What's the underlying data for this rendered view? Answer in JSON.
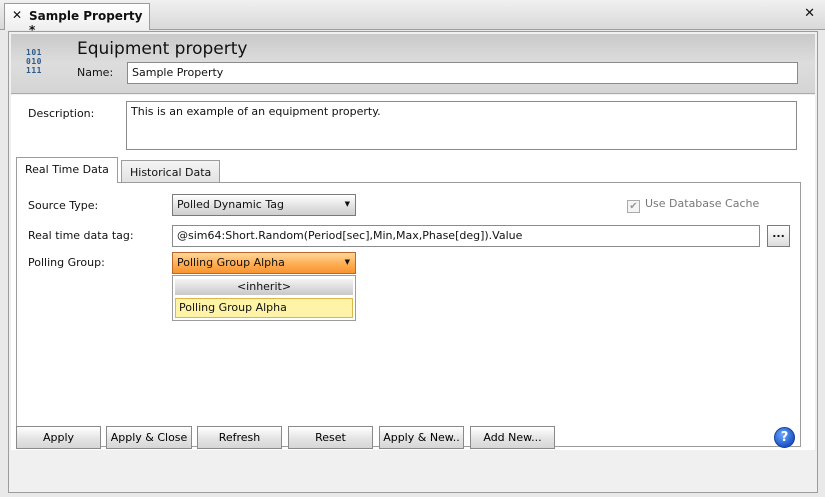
{
  "doc_tab": {
    "title": "Sample Property *",
    "close_glyph": "✕"
  },
  "window_close_glyph": "✕",
  "header": {
    "icon_name": "binary-data-icon",
    "icon_lines": [
      "101",
      "010",
      "111"
    ],
    "title": "Equipment property",
    "name_label": "Name:",
    "name_value": "Sample Property"
  },
  "description": {
    "label": "Description:",
    "value": "This is an example of an equipment property."
  },
  "tabs": [
    {
      "label": "Real Time Data",
      "active": true
    },
    {
      "label": "Historical Data",
      "active": false
    }
  ],
  "realtime": {
    "source_type_label": "Source Type:",
    "source_type_value": "Polled Dynamic Tag",
    "use_cache_label": "Use Database Cache",
    "use_cache_checked": true,
    "tag_label": "Real time data tag:",
    "tag_value": "@sim64:Short.Random(Period[sec],Min,Max,Phase[deg]).Value",
    "browse_label": "...",
    "polling_group_label": "Polling Group:",
    "polling_group_value": "Polling Group Alpha",
    "polling_group_options": [
      "<inherit>",
      "Polling Group Alpha"
    ]
  },
  "buttons": {
    "apply": "Apply",
    "apply_close": "Apply & Close",
    "refresh": "Refresh",
    "reset": "Reset",
    "apply_new": "Apply & New..",
    "add_new": "Add New...",
    "help": "?"
  },
  "colors": {
    "accent_orange": "#f79431",
    "selected_highlight": "#fff3a8",
    "help_blue": "#1d55c5"
  }
}
